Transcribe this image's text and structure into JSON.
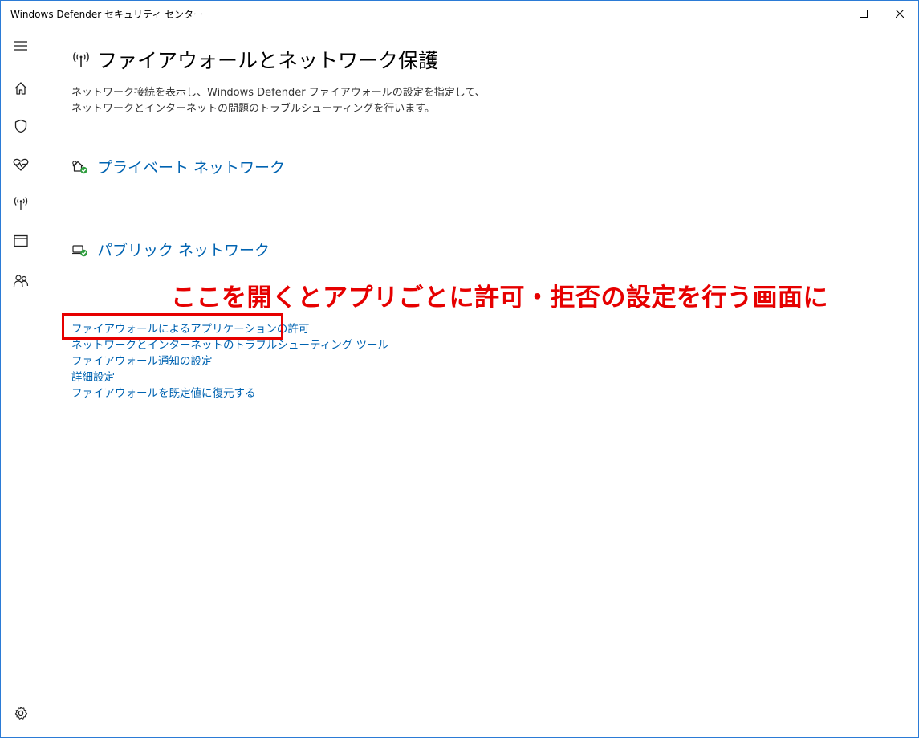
{
  "window": {
    "title": "Windows Defender セキュリティ センター"
  },
  "sidebar": {
    "items": [
      {
        "icon": "hamburger-menu-icon"
      },
      {
        "icon": "home-icon"
      },
      {
        "icon": "shield-icon"
      },
      {
        "icon": "heart-pulse-icon"
      },
      {
        "icon": "wireless-antenna-icon"
      },
      {
        "icon": "browser-window-icon"
      },
      {
        "icon": "family-icon"
      },
      {
        "icon": "gear-icon"
      }
    ]
  },
  "page": {
    "title": "ファイアウォールとネットワーク保護",
    "description_line1": "ネットワーク接続を表示し、Windows Defender ファイアウォールの設定を指定して、",
    "description_line2": "ネットワークとインターネットの問題のトラブルシューティングを行います。"
  },
  "networks": {
    "private": {
      "label": "プライベート ネットワーク",
      "icon": "private-network-icon"
    },
    "public": {
      "label": "パブリック ネットワーク",
      "icon": "public-network-icon"
    }
  },
  "links": [
    "ファイアウォールによるアプリケーションの許可",
    "ネットワークとインターネットのトラブルシューティング ツール",
    "ファイアウォール通知の設定",
    "詳細設定",
    "ファイアウォールを既定値に復元する"
  ],
  "annotation": {
    "text": "ここを開くとアプリごとに許可・拒否の設定を行う画面に",
    "color": "#e60000"
  },
  "colors": {
    "link": "#0063b1",
    "status_ok": "#2e9e3e",
    "border": "#2b7bd6"
  }
}
